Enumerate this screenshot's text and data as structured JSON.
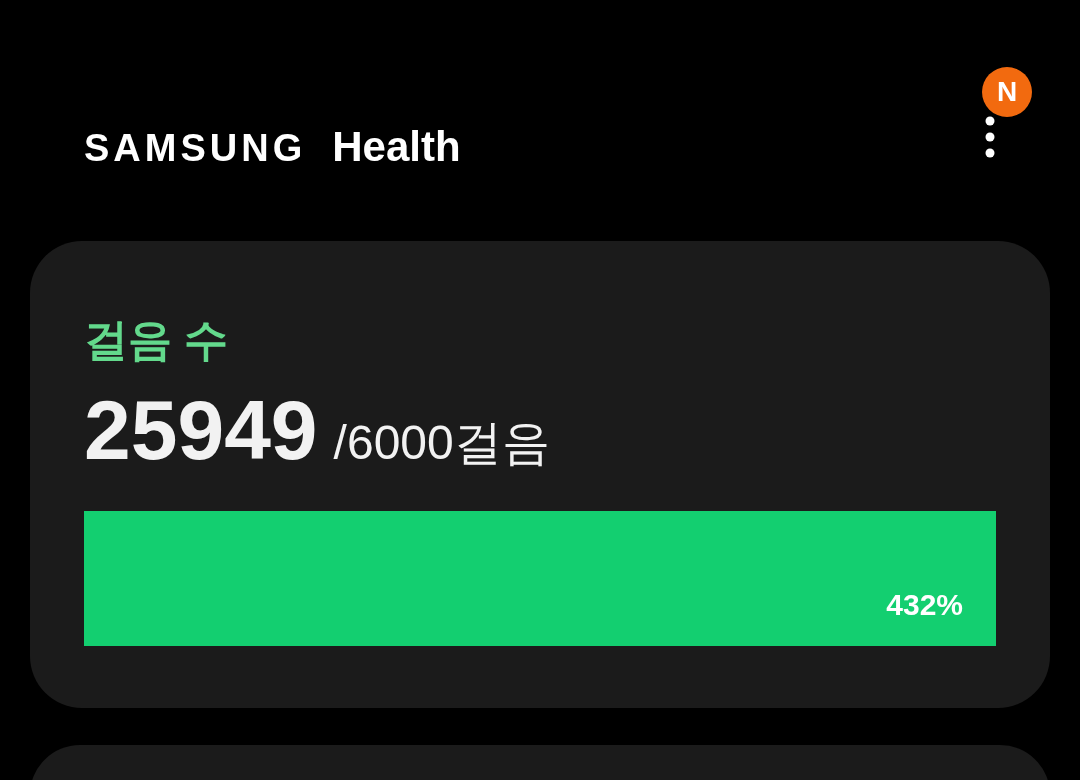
{
  "header": {
    "brand": "SAMSUNG",
    "product": "Health",
    "badge": "N"
  },
  "steps_card": {
    "title": "걸음 수",
    "count": "25949",
    "goal": "/6000걸음",
    "percent": "432%"
  },
  "next_card": {
    "kind": "card"
  }
}
